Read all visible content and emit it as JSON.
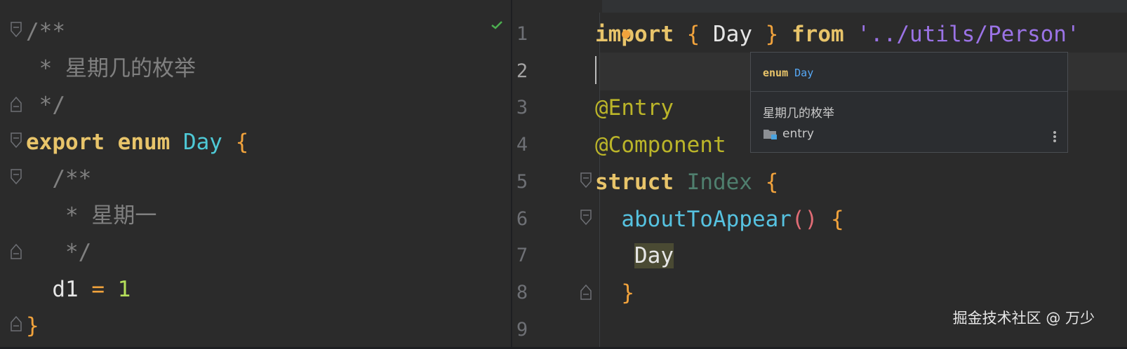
{
  "left_editor": {
    "lines": [
      {
        "id": "l1",
        "segments": [
          {
            "c": "comment",
            "t": "/**"
          }
        ]
      },
      {
        "id": "l2",
        "segments": [
          {
            "c": "comment",
            "t": " * 星期几的枚举"
          }
        ]
      },
      {
        "id": "l3",
        "segments": [
          {
            "c": "comment",
            "t": " */"
          }
        ]
      },
      {
        "id": "l4",
        "segments": [
          {
            "c": "kw2",
            "t": "export"
          },
          {
            "c": "plain",
            "t": " "
          },
          {
            "c": "kw2",
            "t": "enum"
          },
          {
            "c": "plain",
            "t": " "
          },
          {
            "c": "typecyan",
            "t": "Day"
          },
          {
            "c": "plain",
            "t": " "
          },
          {
            "c": "brace",
            "t": "{"
          }
        ]
      },
      {
        "id": "l5",
        "segments": [
          {
            "c": "comment",
            "t": "  /**"
          }
        ]
      },
      {
        "id": "l6",
        "segments": [
          {
            "c": "comment",
            "t": "   * 星期一"
          }
        ]
      },
      {
        "id": "l7",
        "segments": [
          {
            "c": "comment",
            "t": "   */"
          }
        ]
      },
      {
        "id": "l8",
        "segments": [
          {
            "c": "plain",
            "t": "  d1 "
          },
          {
            "c": "op",
            "t": "="
          },
          {
            "c": "plain",
            "t": " "
          },
          {
            "c": "num",
            "t": "1"
          }
        ]
      },
      {
        "id": "l9",
        "segments": [
          {
            "c": "brace",
            "t": "}"
          }
        ]
      }
    ]
  },
  "right_editor": {
    "line_numbers": [
      "1",
      "2",
      "3",
      "4",
      "5",
      "6",
      "7",
      "8",
      "9"
    ],
    "current_line": "2",
    "lines": [
      {
        "id": "r1",
        "segments": [
          {
            "c": "kw2",
            "t": "import"
          },
          {
            "c": "plain",
            "t": " "
          },
          {
            "c": "brace",
            "t": "{"
          },
          {
            "c": "plain",
            "t": " Day "
          },
          {
            "c": "brace",
            "t": "}"
          },
          {
            "c": "plain",
            "t": " "
          },
          {
            "c": "kw2",
            "t": "from"
          },
          {
            "c": "plain",
            "t": " "
          },
          {
            "c": "str",
            "t": "'../utils/Person'"
          }
        ]
      },
      {
        "id": "r2",
        "segments": []
      },
      {
        "id": "r3",
        "segments": [
          {
            "c": "anno",
            "t": "@Entry"
          }
        ]
      },
      {
        "id": "r4",
        "segments": [
          {
            "c": "anno",
            "t": "@Component"
          }
        ]
      },
      {
        "id": "r5",
        "segments": [
          {
            "c": "kw2",
            "t": "struct"
          },
          {
            "c": "plain",
            "t": " "
          },
          {
            "c": "typegray",
            "t": "Index"
          },
          {
            "c": "plain",
            "t": " "
          },
          {
            "c": "brace",
            "t": "{"
          }
        ]
      },
      {
        "id": "r6",
        "segments": [
          {
            "c": "plain",
            "t": "  "
          },
          {
            "c": "fn",
            "t": "aboutToAppear"
          },
          {
            "c": "paren",
            "t": "()"
          },
          {
            "c": "plain",
            "t": " "
          },
          {
            "c": "brace",
            "t": "{"
          }
        ]
      },
      {
        "id": "r7",
        "segments": [
          {
            "c": "plain",
            "t": "   "
          },
          {
            "c": "hl",
            "t": "Day"
          }
        ]
      },
      {
        "id": "r8",
        "segments": [
          {
            "c": "plain",
            "t": "  "
          },
          {
            "c": "brace",
            "t": "}"
          }
        ]
      },
      {
        "id": "r9",
        "segments": []
      }
    ]
  },
  "popup": {
    "sig_keyword": "enum",
    "sig_type": "Day",
    "description": "星期几的枚举",
    "module": "entry"
  },
  "watermark": "掘金技术社区 @ 万少",
  "colors": {
    "background": "#2b2b2b",
    "keyword": "#e8c46a",
    "string": "#9b73e6",
    "annotation": "#bbb529",
    "comment": "#808080"
  }
}
